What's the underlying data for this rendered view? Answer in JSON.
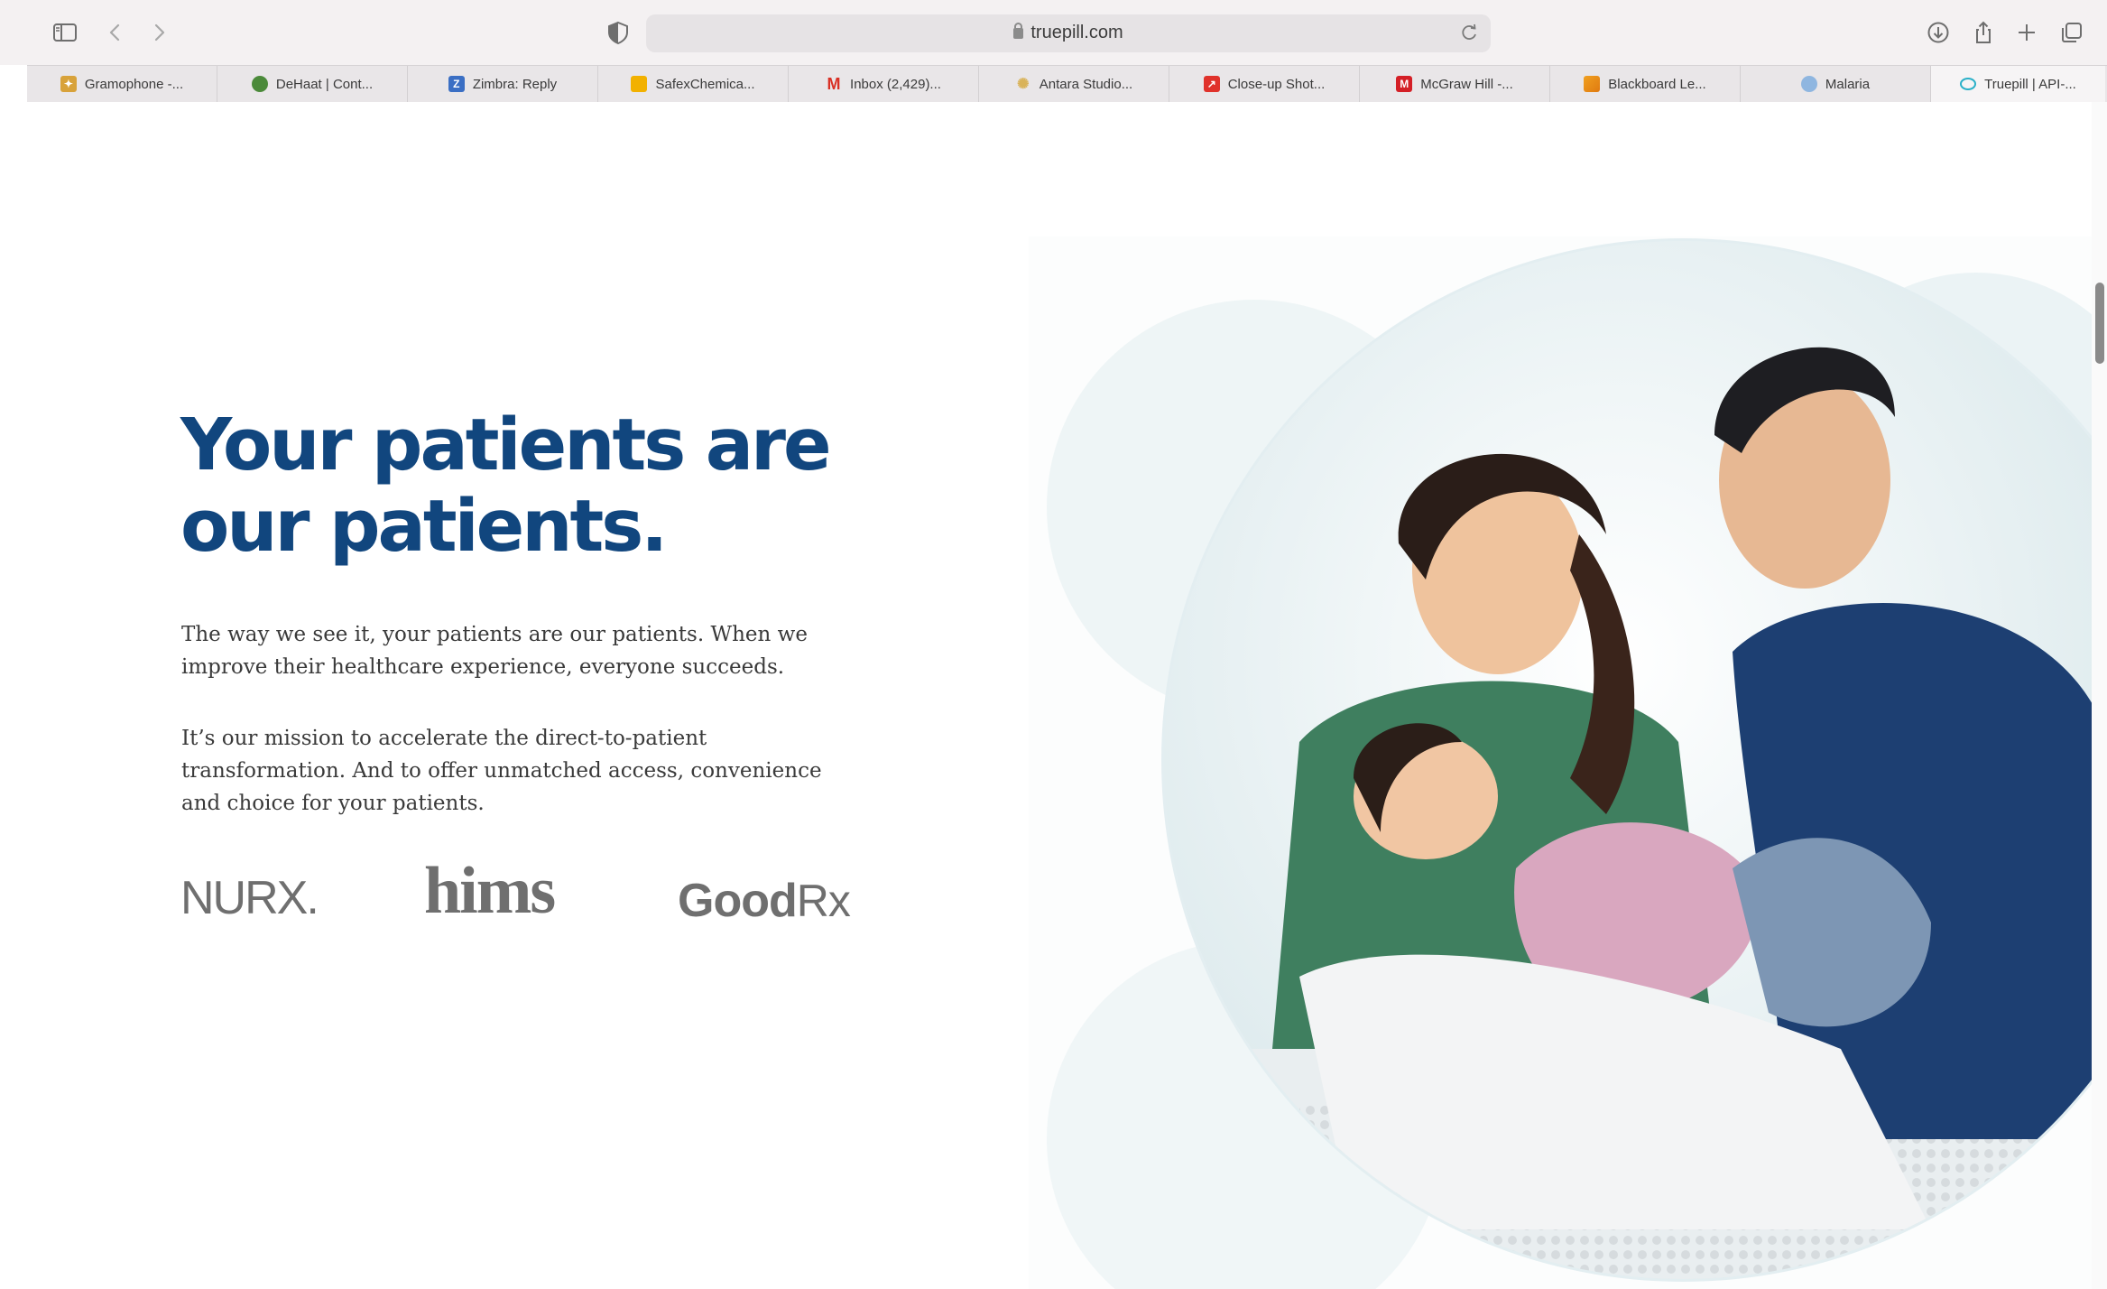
{
  "browser": {
    "url": "truepill.com",
    "tabs": [
      {
        "label": "Gramophone -...",
        "icon": "gramophone-favicon",
        "color": "#d8a23a"
      },
      {
        "label": "DeHaat | Cont...",
        "icon": "dehaat-favicon",
        "color": "#4b8a3a"
      },
      {
        "label": "Zimbra: Reply",
        "icon": "zimbra-favicon",
        "color": "#3b6fc4"
      },
      {
        "label": "SafexChemica...",
        "icon": "safex-favicon",
        "color": "#f2b100"
      },
      {
        "label": "Inbox (2,429)...",
        "icon": "gmail-favicon",
        "color": "#d93025"
      },
      {
        "label": "Antara Studio...",
        "icon": "antara-favicon",
        "color": "#e0c070"
      },
      {
        "label": "Close-up Shot...",
        "icon": "closeup-favicon",
        "color": "#e0322b"
      },
      {
        "label": "McGraw Hill -...",
        "icon": "mcgraw-hill-favicon",
        "color": "#d41f26"
      },
      {
        "label": "Blackboard Le...",
        "icon": "blackboard-favicon",
        "color": "#f0a020"
      },
      {
        "label": "Malaria",
        "icon": "who-favicon",
        "color": "#6aa0d8"
      },
      {
        "label": "Truepill | API-...",
        "icon": "truepill-favicon",
        "color": "#2ab0c8",
        "active": true
      }
    ]
  },
  "hero": {
    "headline_line1": "Your patients are",
    "headline_line2": "our patients.",
    "paragraph1": "The way we see it, your patients are our patients. When we improve their healthcare experience, everyone succeeds.",
    "paragraph2": "It’s our mission to accelerate the direct-to-patient transformation. And to offer unmatched access, convenience and choice for your patients.",
    "headline_color": "#11467e"
  },
  "logos": {
    "nurx": "NURX.",
    "hims": "hims",
    "goodrx_main": "Good",
    "goodrx_rx": "Rx"
  }
}
